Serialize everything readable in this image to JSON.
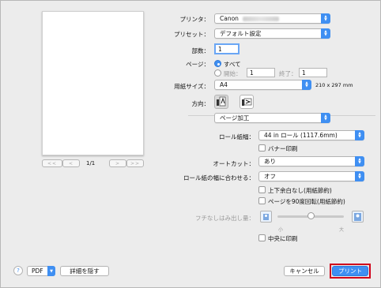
{
  "window": {
    "accent": "#3f8ff2",
    "highlight": "#d0021b"
  },
  "preview": {
    "page_indicator": "1/1",
    "first_label": "<<",
    "prev_label": "<",
    "next_label": ">",
    "last_label": ">>"
  },
  "printer": {
    "label": "プリンタ：",
    "value": "Canon"
  },
  "preset": {
    "label": "プリセット：",
    "value": "デフォルト設定"
  },
  "copies": {
    "label": "部数：",
    "value": "1"
  },
  "pages": {
    "label": "ページ：",
    "all_label": "すべて",
    "from_label": "開始：",
    "from_value": "1",
    "to_label": "終了：",
    "to_value": "1",
    "selected": "all"
  },
  "paper_size": {
    "label": "用紙サイズ：",
    "value": "A4",
    "dims": "210 x 297 mm"
  },
  "orientation": {
    "label": "方向：",
    "selected": "portrait"
  },
  "section": {
    "value": "ページ加工"
  },
  "roll_width": {
    "label": "ロール紙幅：",
    "value": "44 in ロール (1117.6mm)"
  },
  "banner": {
    "label": "バナー印刷",
    "checked": false
  },
  "auto_cut": {
    "label": "オートカット：",
    "value": "あり"
  },
  "fit_roll": {
    "label": "ロール紙の幅に合わせる：",
    "value": "オフ"
  },
  "no_margin": {
    "label": "上下余白なし(用紙節約)",
    "checked": false
  },
  "rotate90": {
    "label": "ページを90度回転(用紙節約)",
    "checked": false
  },
  "overflow": {
    "label": "フチなしはみ出し量：",
    "min_label": "小",
    "max_label": "大",
    "level": 0.5
  },
  "center": {
    "label": "中央に印刷",
    "checked": false
  },
  "footer": {
    "help": "?",
    "pdf_label": "PDF",
    "hide_details": "詳細を隠す",
    "cancel": "キャンセル",
    "print": "プリント"
  }
}
